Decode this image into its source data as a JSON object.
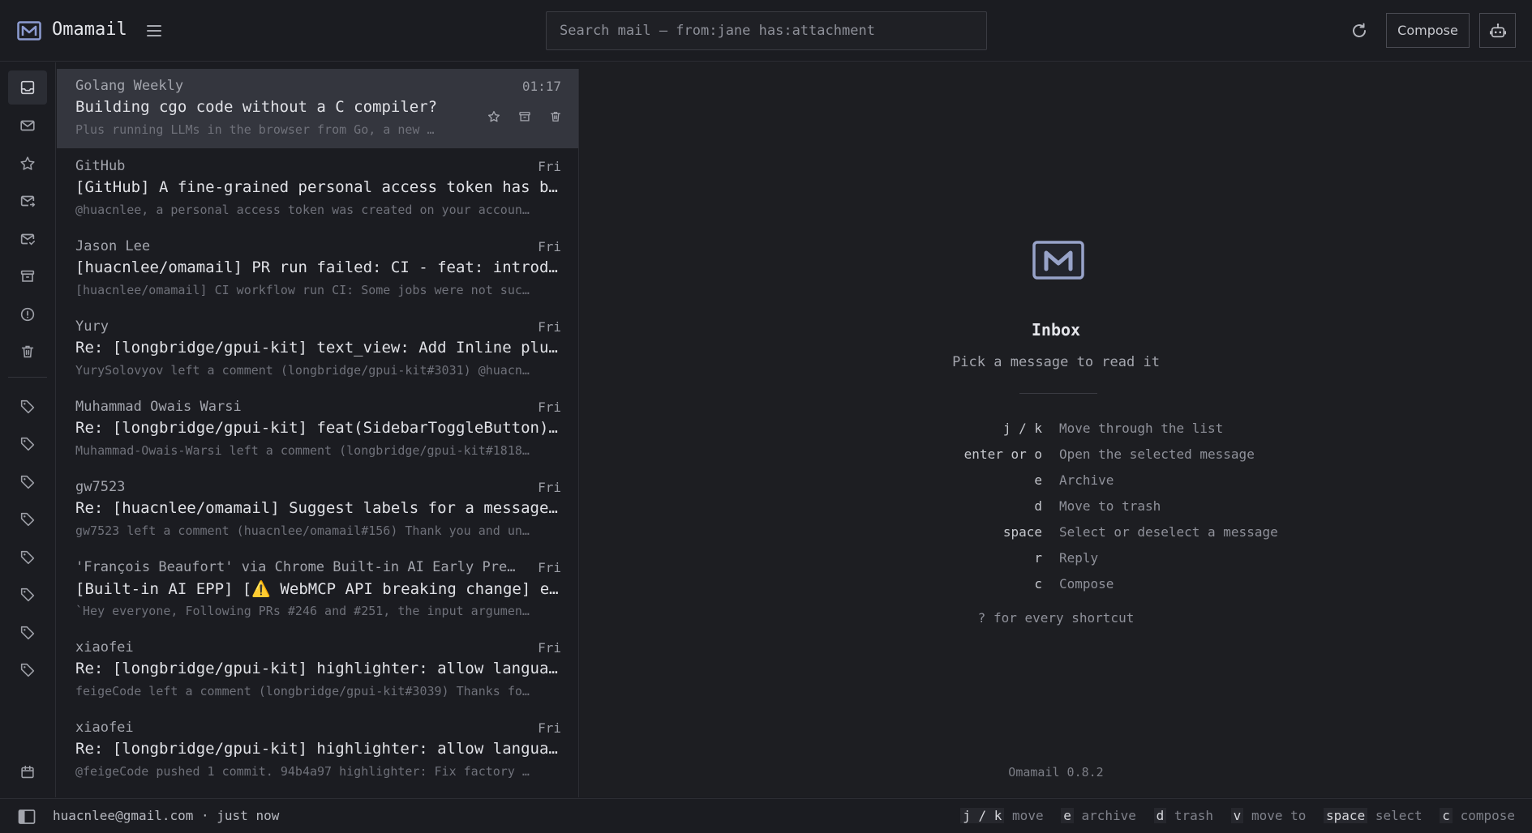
{
  "app": {
    "title": "Omamail",
    "version": "Omamail 0.8.2"
  },
  "search": {
    "placeholder": "Search mail — from:jane has:attachment"
  },
  "header": {
    "compose_label": "Compose"
  },
  "rail": {
    "mail_items": [
      "inbox-icon",
      "mail-icon",
      "star-icon",
      "mail-send-icon",
      "mail-check-icon",
      "archive-icon",
      "alert-icon",
      "trash-icon"
    ],
    "label_count": 8,
    "bottom_item": "calendar-icon"
  },
  "messages": [
    {
      "sender": "Golang Weekly",
      "time": "01:17",
      "subject": "Building cgo code without a C compiler?",
      "snippet": "Plus running LLMs in the browser from Go, a new …"
    },
    {
      "sender": "GitHub",
      "time": "Fri",
      "subject": "[GitHub] A fine-grained personal access token has b…",
      "snippet": "@huacnlee, a personal access token was created on your accoun…"
    },
    {
      "sender": "Jason Lee",
      "time": "Fri",
      "subject": "[huacnlee/omamail] PR run failed: CI - feat: introd…",
      "snippet": "[huacnlee/omamail] CI workflow run CI: Some jobs were not suc…"
    },
    {
      "sender": "Yury",
      "time": "Fri",
      "subject": "Re: [longbridge/gpui-kit] text_view: Add Inline plu…",
      "snippet": "YurySolovyov left a comment (longbridge/gpui-kit#3031) @huacn…"
    },
    {
      "sender": "Muhammad Owais Warsi",
      "time": "Fri",
      "subject": "Re: [longbridge/gpui-kit] feat(SidebarToggleButton)…",
      "snippet": "Muhammad-Owais-Warsi left a comment (longbridge/gpui-kit#1818…"
    },
    {
      "sender": "gw7523",
      "time": "Fri",
      "subject": "Re: [huacnlee/omamail] Suggest labels for a message…",
      "snippet": "gw7523 left a comment (huacnlee/omamail#156) Thank you and un…"
    },
    {
      "sender": "'François Beaufort' via Chrome Built-in AI Early Pre…",
      "time": "Fri",
      "subject": "[Built-in AI EPP] [⚠️ WebMCP API breaking change] e…",
      "snippet": "`Hey everyone, Following PRs #246 and #251, the input argumen…"
    },
    {
      "sender": "xiaofei",
      "time": "Fri",
      "subject": "Re: [longbridge/gpui-kit] highlighter: allow langua…",
      "snippet": "feigeCode left a comment (longbridge/gpui-kit#3039) Thanks fo…"
    },
    {
      "sender": "xiaofei",
      "time": "Fri",
      "subject": "Re: [longbridge/gpui-kit] highlighter: allow langua…",
      "snippet": "@feigeCode pushed 1 commit. 94b4a97 highlighter: Fix factory …"
    }
  ],
  "pane": {
    "title": "Inbox",
    "subtitle": "Pick a message to read it",
    "shortcuts": [
      {
        "key": "j / k",
        "desc": "Move through the list"
      },
      {
        "key": "enter or o",
        "desc": "Open the selected message"
      },
      {
        "key": "e",
        "desc": "Archive"
      },
      {
        "key": "d",
        "desc": "Move to trash"
      },
      {
        "key": "space",
        "desc": "Select or deselect a message"
      },
      {
        "key": "r",
        "desc": "Reply"
      },
      {
        "key": "c",
        "desc": "Compose"
      }
    ],
    "hint": "? for every shortcut"
  },
  "status": {
    "account": "huacnlee@gmail.com · just now",
    "keys": [
      {
        "key": "j / k",
        "desc": "move"
      },
      {
        "key": "e",
        "desc": "archive"
      },
      {
        "key": "d",
        "desc": "trash"
      },
      {
        "key": "v",
        "desc": "move to"
      },
      {
        "key": "space",
        "desc": "select"
      },
      {
        "key": "c",
        "desc": "compose"
      }
    ]
  },
  "colors": {
    "background": "#1b1c21",
    "selected_row": "#34363e",
    "accent_logo": "#7f8fc8"
  }
}
